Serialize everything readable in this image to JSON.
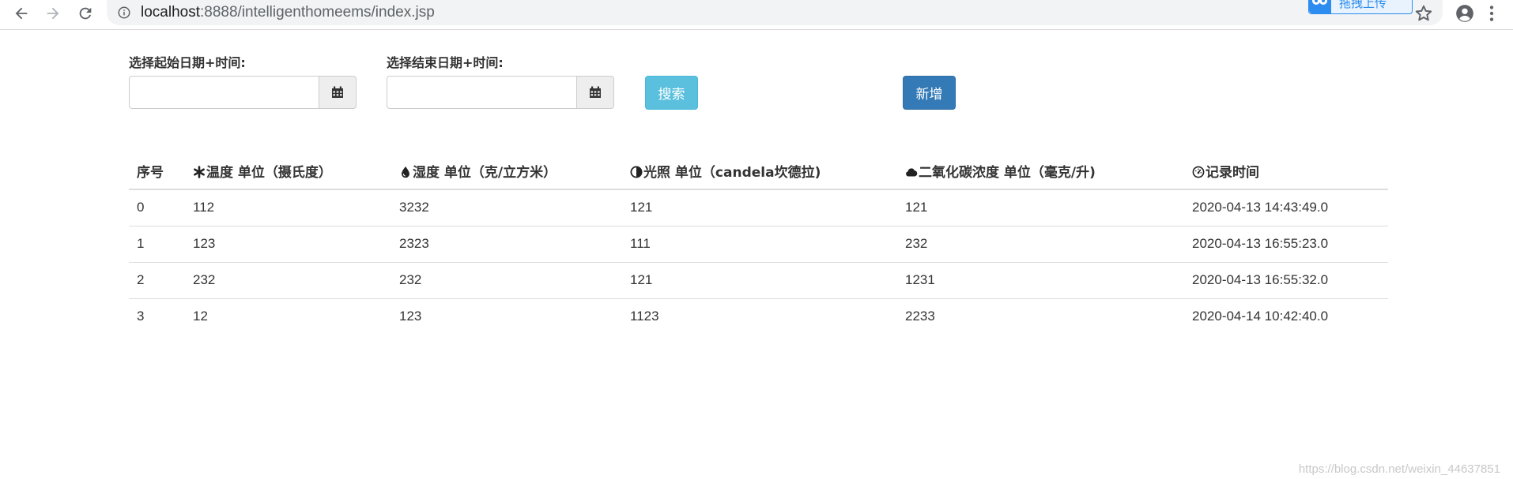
{
  "browser": {
    "url_host": "localhost",
    "url_rest": ":8888/intelligenthomeems/index.jsp",
    "extension_badge": "拖拽上传"
  },
  "form": {
    "start_label": "选择起始日期+时间:",
    "start_value": "",
    "end_label": "选择结束日期+时间:",
    "end_value": "",
    "search_button": "搜索",
    "add_button": "新增",
    "calendar_icon": "calendar-icon"
  },
  "table": {
    "headers": [
      {
        "label": "序号",
        "icon": ""
      },
      {
        "label": "温度 单位（摄氏度）",
        "icon": "asterisk-icon"
      },
      {
        "label": "湿度 单位（克/立方米）",
        "icon": "tint-icon"
      },
      {
        "label": "光照 单位（candela坎德拉)",
        "icon": "adjust-icon"
      },
      {
        "label": "二氧化碳浓度 单位（毫克/升)",
        "icon": "cloud-icon"
      },
      {
        "label": "记录时间",
        "icon": "dashboard-icon"
      }
    ],
    "rows": [
      [
        "0",
        "112",
        "3232",
        "121",
        "121",
        "2020-04-13 14:43:49.0"
      ],
      [
        "1",
        "123",
        "2323",
        "111",
        "232",
        "2020-04-13 16:55:23.0"
      ],
      [
        "2",
        "232",
        "232",
        "121",
        "1231",
        "2020-04-13 16:55:32.0"
      ],
      [
        "3",
        "12",
        "123",
        "1123",
        "2233",
        "2020-04-14 10:42:40.0"
      ]
    ]
  },
  "watermark": "https://blog.csdn.net/weixin_44637851",
  "colors": {
    "search_button": "#5bc0de",
    "add_button": "#337ab7",
    "border": "#dddddd"
  }
}
